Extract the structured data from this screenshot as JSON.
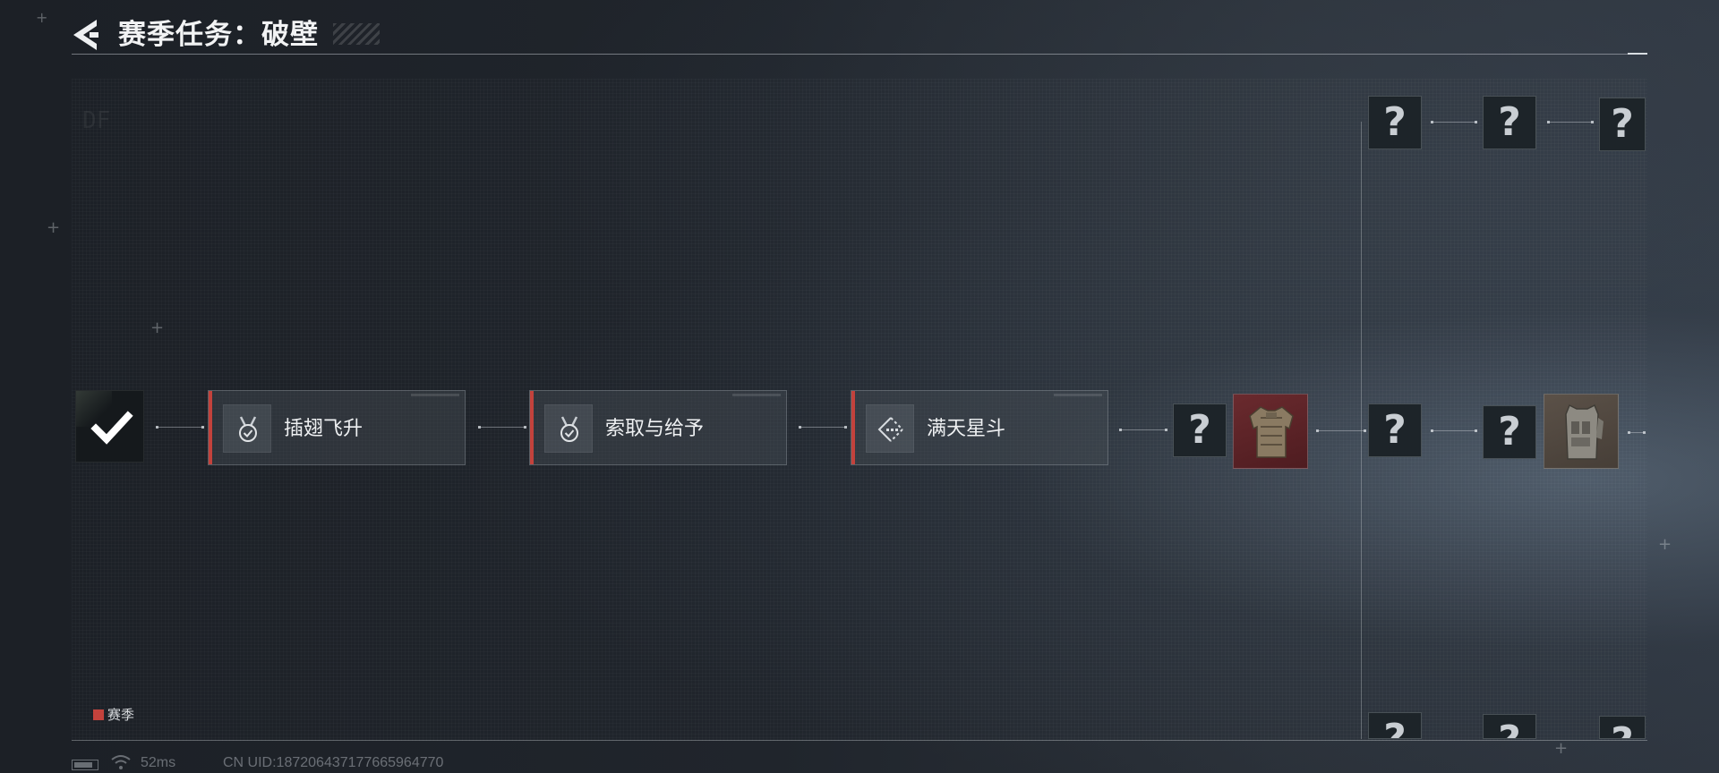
{
  "header": {
    "title": "赛季任务：破壁"
  },
  "icons": {
    "back": "back-arrow-icon",
    "completed": "checkmark-icon",
    "task_1": "medal-check-icon",
    "task_2": "medal-check-icon",
    "task_3": "diamond-pattern-icon",
    "mystery": "question-mark-icon",
    "reward_1": "body-armor-icon",
    "reward_2": "tactical-vest-icon",
    "network": "wifi-icon",
    "battery": "battery-icon"
  },
  "tasks": [
    {
      "label": "插翅飞升",
      "status": "active"
    },
    {
      "label": "索取与给予",
      "status": "active"
    },
    {
      "label": "满天星斗",
      "status": "active"
    }
  ],
  "mystery_symbol": "?",
  "legend": {
    "label": "赛季",
    "color": "#c3423c"
  },
  "status_bar": {
    "ping": "52ms",
    "uid": "CN UID:18720643717766596477​0"
  },
  "colors": {
    "accent": "#c3423c",
    "reward_red": "#6a2a2e",
    "reward_tan": "#5b5148"
  }
}
